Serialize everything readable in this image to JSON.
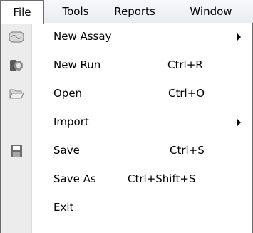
{
  "menubar": {
    "items": [
      {
        "label": "File"
      },
      {
        "label": "Tools"
      },
      {
        "label": "Reports"
      },
      {
        "label": "Window"
      }
    ]
  },
  "file_menu": {
    "items": [
      {
        "label": "New Assay",
        "shortcut": "",
        "submenu": true,
        "icon": "assay-icon"
      },
      {
        "label": "New Run",
        "shortcut": "Ctrl+R",
        "submenu": false,
        "icon": "run-icon"
      },
      {
        "label": "Open",
        "shortcut": "Ctrl+O",
        "submenu": false,
        "icon": "folder-open-icon"
      },
      {
        "label": "Import",
        "shortcut": "",
        "submenu": true,
        "icon": ""
      },
      {
        "label": "Save",
        "shortcut": "Ctrl+S",
        "submenu": false,
        "icon": "save-icon"
      },
      {
        "label": "Save As",
        "shortcut": "Ctrl+Shift+S",
        "submenu": false,
        "icon": ""
      },
      {
        "label": "Exit",
        "shortcut": "",
        "submenu": false,
        "icon": ""
      }
    ]
  }
}
